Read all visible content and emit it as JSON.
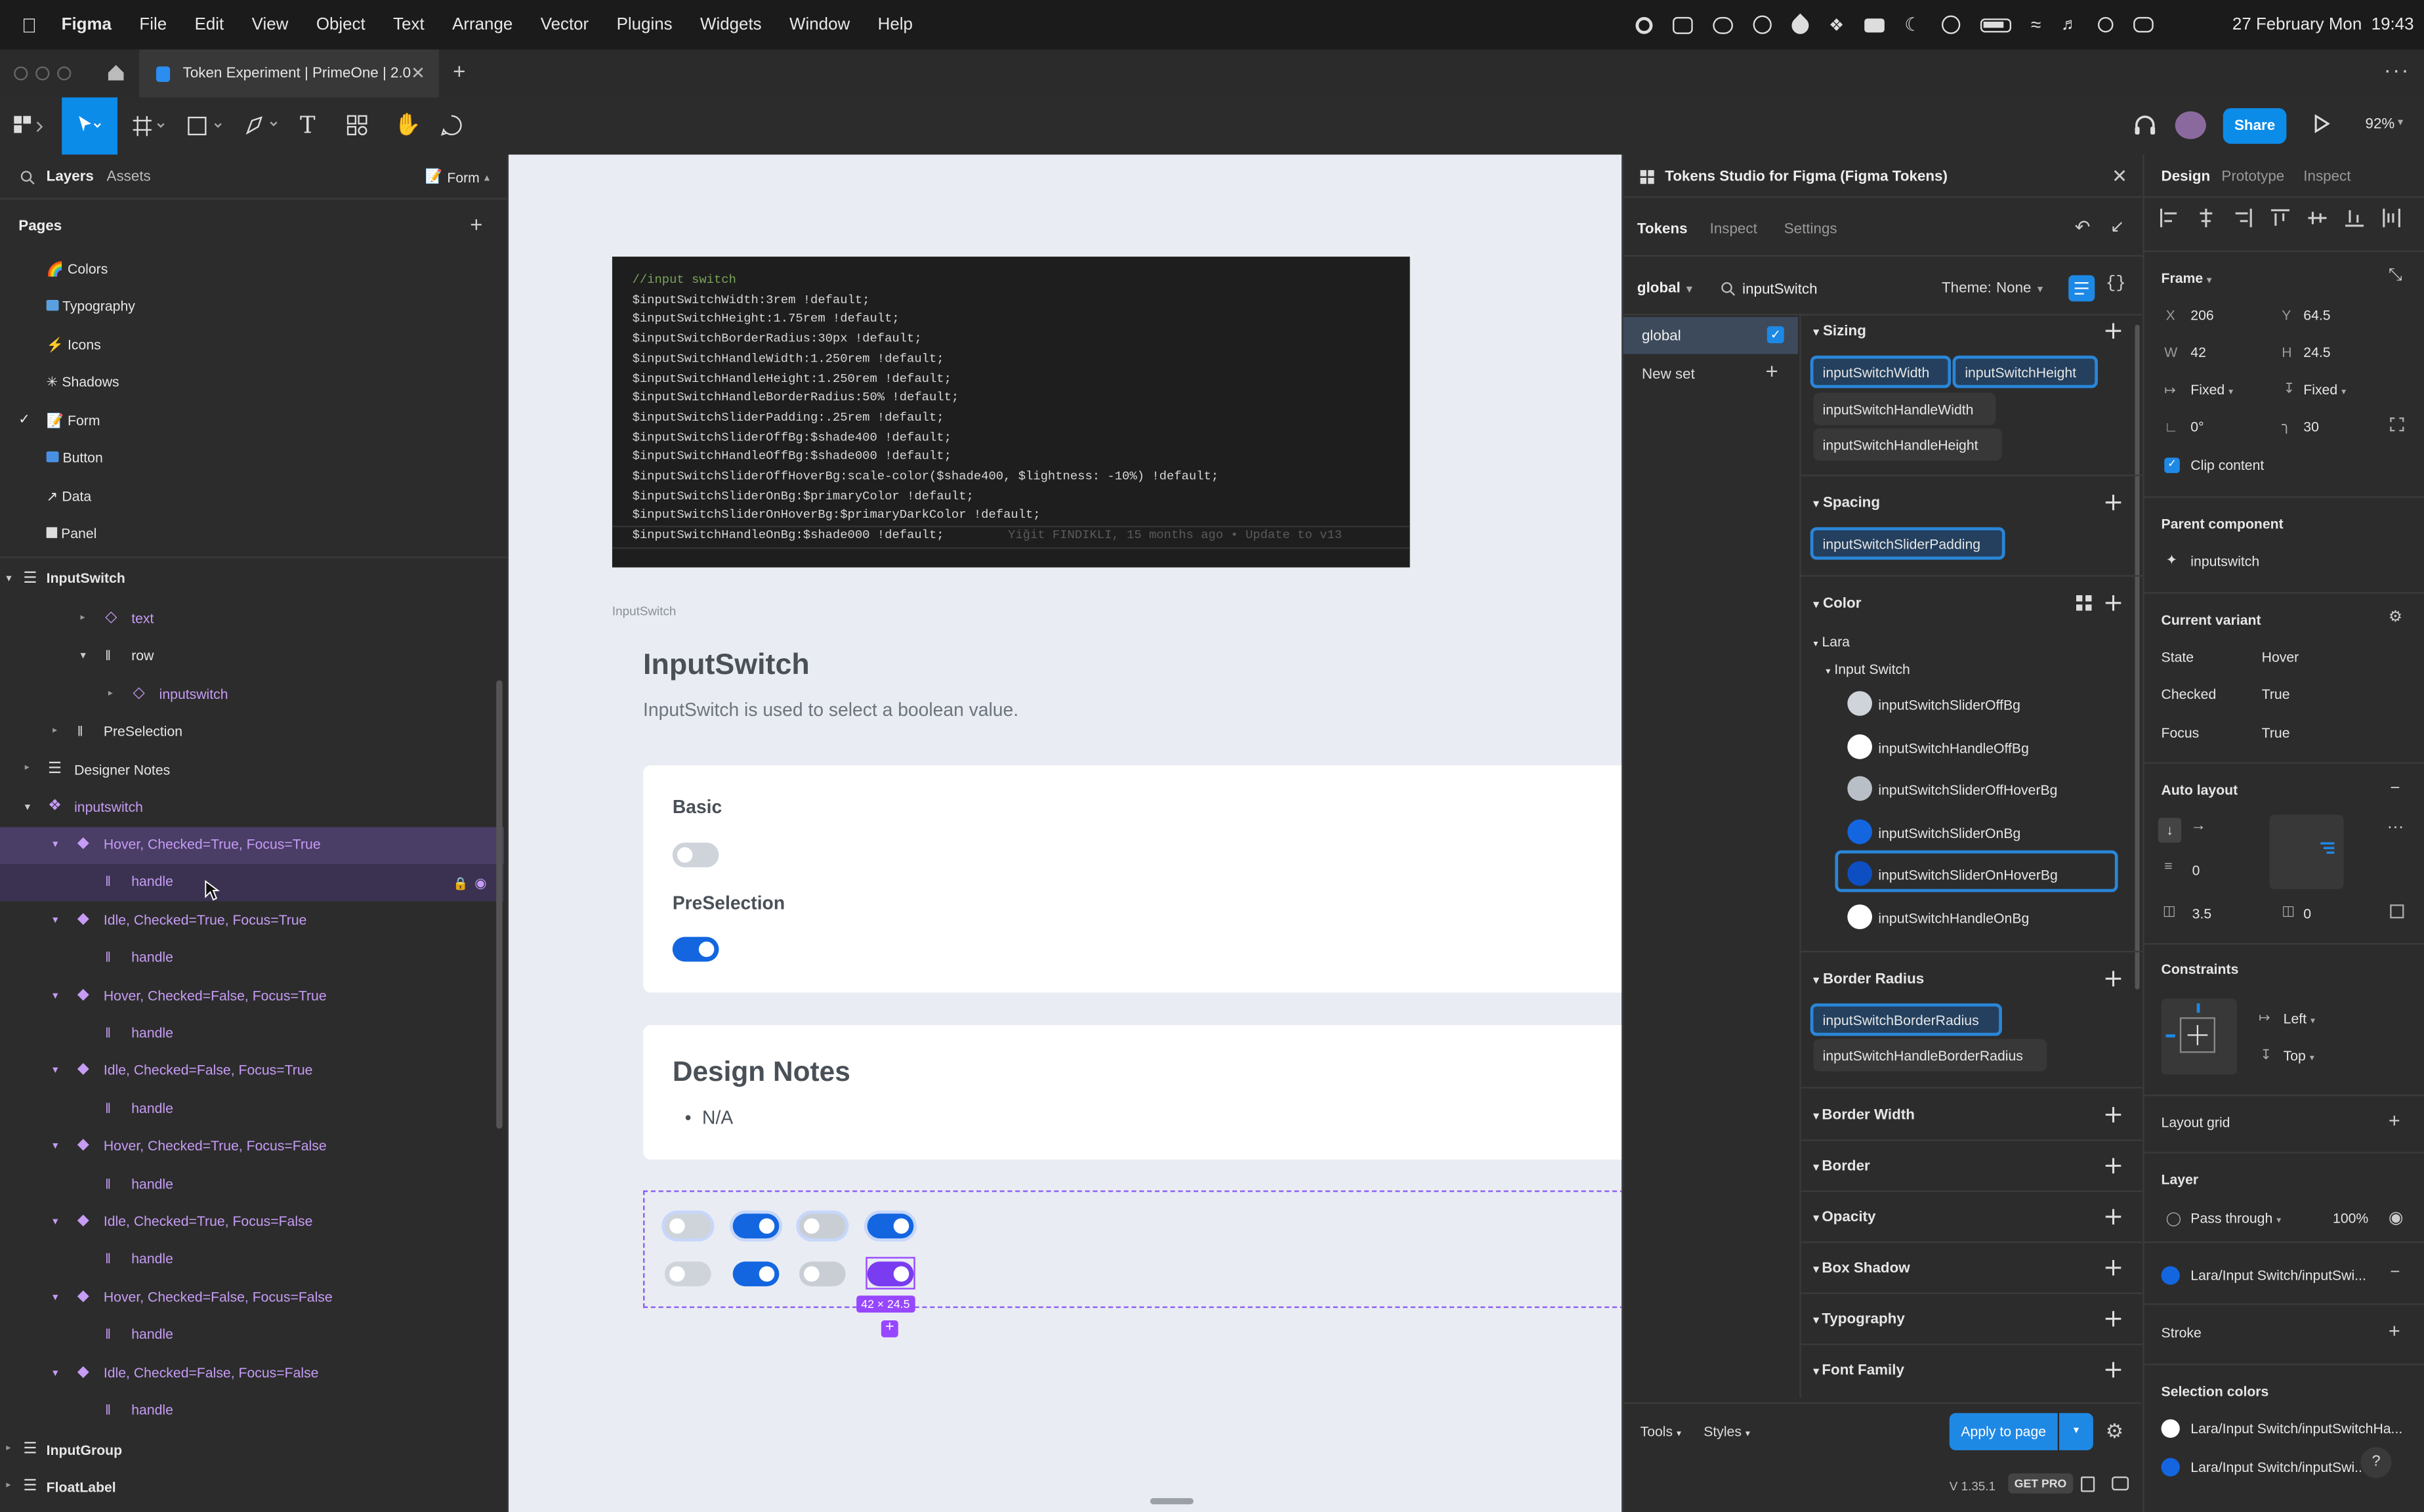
{
  "menubar": {
    "app": "Figma",
    "items": [
      "File",
      "Edit",
      "View",
      "Object",
      "Text",
      "Arrange",
      "Vector",
      "Plugins",
      "Widgets",
      "Window",
      "Help"
    ],
    "datetime": "27 February Mon  19:43"
  },
  "tab": {
    "title": "Token Experiment | PrimeOne | 2.0"
  },
  "toolbar": {
    "share": "Share",
    "zoom": "92%"
  },
  "left": {
    "tab_layers": "Layers",
    "tab_assets": "Assets",
    "page_selector": "Form",
    "pages_title": "Pages",
    "pages": [
      "Colors",
      "Typography",
      "Icons",
      "Shadows",
      "Form",
      "Button",
      "Data",
      "Panel"
    ],
    "layers": {
      "inputswitch_frame": "InputSwitch",
      "text": "text",
      "row": "row",
      "inputswitch_inst": "inputswitch",
      "preselection": "PreSelection",
      "designer_notes": "Designer Notes",
      "inputswitch_comp": "inputswitch",
      "variants": [
        "Hover, Checked=True, Focus=True",
        "Idle, Checked=True, Focus=True",
        "Hover, Checked=False, Focus=True",
        "Idle, Checked=False, Focus=True",
        "Hover, Checked=True, Focus=False",
        "Idle, Checked=True, Focus=False",
        "Hover, Checked=False, Focus=False",
        "Idle, Checked=False, Focus=False"
      ],
      "handle": "handle",
      "inputgroup": "InputGroup",
      "floatlabel": "FloatLabel"
    }
  },
  "canvas": {
    "code": [
      "//input switch",
      "$inputSwitchWidth:3rem !default;",
      "$inputSwitchHeight:1.75rem !default;",
      "$inputSwitchBorderRadius:30px !default;",
      "$inputSwitchHandleWidth:1.250rem !default;",
      "$inputSwitchHandleHeight:1.250rem !default;",
      "$inputSwitchHandleBorderRadius:50% !default;",
      "$inputSwitchSliderPadding:.25rem !default;",
      "$inputSwitchSliderOffBg:$shade400 !default;",
      "$inputSwitchHandleOffBg:$shade000 !default;",
      "$inputSwitchSliderOffHoverBg:scale-color($shade400, $lightness: -10%) !default;",
      "$inputSwitchSliderOnBg:$primaryColor !default;",
      "$inputSwitchSliderOnHoverBg:$primaryDarkColor !default;",
      "$inputSwitchHandleOnBg:$shade000 !default;"
    ],
    "blame": "Yiğit FINDIKLI, 15 months ago • Update to v13",
    "frame_label": "InputSwitch",
    "title": "InputSwitch",
    "description": "InputSwitch is used to select a boolean value.",
    "basic": "Basic",
    "preselection": "PreSelection",
    "design_notes_title": "Design Notes",
    "design_notes_item": "N/A",
    "size_badge": "42 × 24.5"
  },
  "plugin": {
    "title": "Tokens Studio for Figma (Figma Tokens)",
    "tabs": [
      "Tokens",
      "Inspect",
      "Settings"
    ],
    "set_select": "global",
    "search": "inputSwitch",
    "theme_label": "Theme:",
    "theme_value": "None",
    "sets": [
      "global",
      "New set"
    ],
    "sizing": {
      "title": "Sizing",
      "tokens": [
        "inputSwitchWidth",
        "inputSwitchHeight",
        "inputSwitchHandleWidth",
        "inputSwitchHandleHeight"
      ]
    },
    "spacing": {
      "title": "Spacing",
      "tokens": [
        "inputSwitchSliderPadding"
      ]
    },
    "color": {
      "title": "Color",
      "group": "Lara",
      "subgroup": "Input Switch",
      "tokens": [
        {
          "name": "inputSwitchSliderOffBg",
          "color": "#ced4da"
        },
        {
          "name": "inputSwitchHandleOffBg",
          "color": "#ffffff"
        },
        {
          "name": "inputSwitchSliderOffHoverBg",
          "color": "#b8bfc6"
        },
        {
          "name": "inputSwitchSliderOnBg",
          "color": "#1366e0"
        },
        {
          "name": "inputSwitchSliderOnHoverBg",
          "color": "#0d4fc2"
        },
        {
          "name": "inputSwitchHandleOnBg",
          "color": "#ffffff"
        }
      ]
    },
    "border_radius": {
      "title": "Border Radius",
      "tokens": [
        "inputSwitchBorderRadius",
        "inputSwitchHandleBorderRadius"
      ]
    },
    "collapsed": [
      "Border Width",
      "Border",
      "Opacity",
      "Box Shadow",
      "Typography",
      "Font Family"
    ],
    "footer": {
      "tools": "Tools",
      "styles": "Styles",
      "apply": "Apply to page",
      "version": "V 1.35.1",
      "pro": "GET PRO"
    }
  },
  "design": {
    "tabs": [
      "Design",
      "Prototype",
      "Inspect"
    ],
    "frame": "Frame",
    "x_label": "X",
    "x": "206",
    "y_label": "Y",
    "y": "64.5",
    "w_label": "W",
    "w": "42",
    "h_label": "H",
    "h": "24.5",
    "fixed_w": "Fixed",
    "fixed_h": "Fixed",
    "rotation": "0°",
    "radius": "30",
    "clip": "Clip content",
    "parent_title": "Parent component",
    "parent": "inputswitch",
    "variant_title": "Current variant",
    "variant": [
      {
        "k": "State",
        "v": "Hover"
      },
      {
        "k": "Checked",
        "v": "True"
      },
      {
        "k": "Focus",
        "v": "True"
      }
    ],
    "autolayout": "Auto layout",
    "spacing_val": "0",
    "pad_h": "3.5",
    "pad_v": "0",
    "constraints": "Constraints",
    "c_left": "Left",
    "c_top": "Top",
    "layout_grid": "Layout grid",
    "layer": "Layer",
    "blend": "Pass through",
    "opacity": "100%",
    "fill": "Lara/Input Switch/inputSwi...",
    "stroke": "Stroke",
    "selection_colors": "Selection colors",
    "sel1": "Lara/Input Switch/inputSwitchHa...",
    "sel2": "Lara/Input Switch/inputSwi..."
  }
}
